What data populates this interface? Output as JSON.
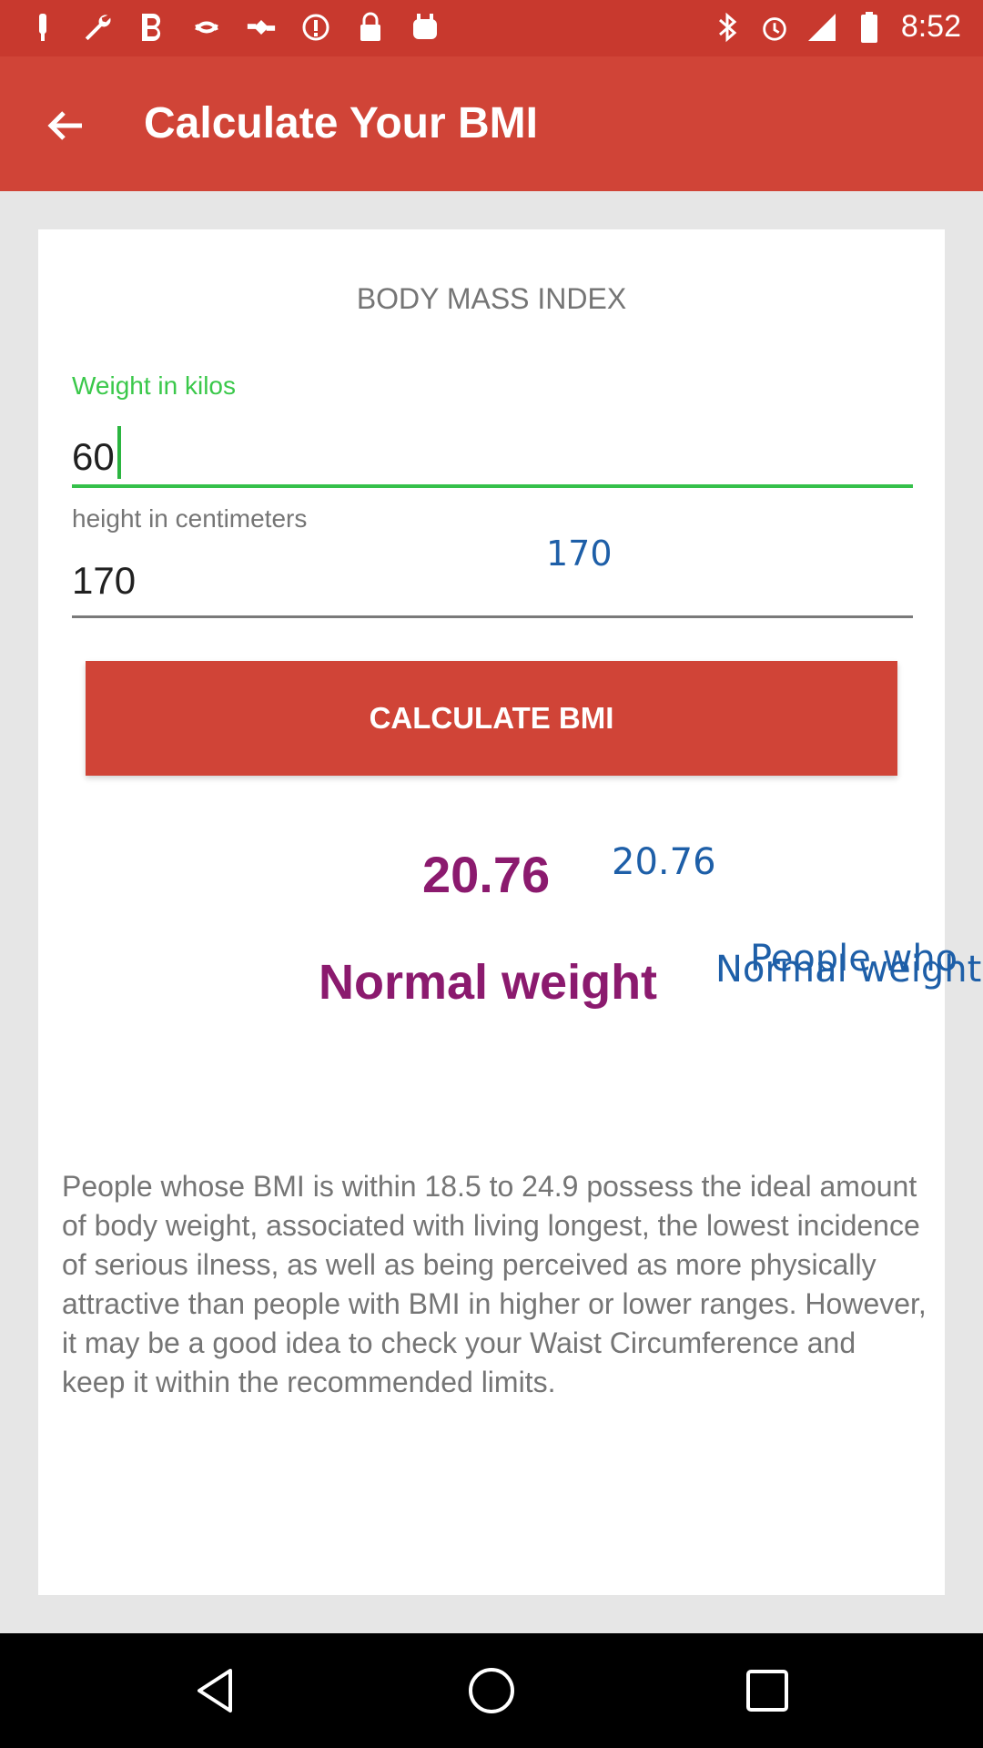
{
  "status_bar": {
    "time": "8:52",
    "icons_left": [
      "notification-icon",
      "wrench-icon",
      "b-icon",
      "sync-icon",
      "satellite-icon",
      "info-icon",
      "lock-icon",
      "android-icon"
    ],
    "icons_right": [
      "bluetooth-icon",
      "alarm-icon",
      "signal-icon",
      "battery-icon"
    ]
  },
  "app_bar": {
    "title": "Calculate Your BMI",
    "back_icon": "arrow-back-icon"
  },
  "form": {
    "heading": "BODY MASS INDEX",
    "weight_label": "Weight in kilos",
    "weight_value": "60",
    "height_label": "height in centimeters",
    "height_value": "170",
    "height_echo": "170",
    "button_label": "CALCULATE BMI"
  },
  "result": {
    "bmi": "20.76",
    "bmi_echo": "20.76",
    "category": "Normal weight",
    "category_echo": "Normal weight",
    "description": "People whose BMI is within 18.5 to 24.9 possess the ideal amount of body weight, associated with living longest, the lowest incidence of serious ilness, as well as being perceived as more physically attractive than people with BMI in higher or lower ranges. However, it may be a good idea to check your Waist Circumference and keep it within the recommended limits.",
    "description_echo": "People who"
  },
  "colors": {
    "primary": "#d04437",
    "status": "#c8392e",
    "accent_green": "#3ac84a",
    "result": "#8b1a6e",
    "debug_blue": "#1e5fa8"
  },
  "nav_bar": {
    "buttons": [
      "back-triangle-icon",
      "home-circle-icon",
      "recents-square-icon"
    ]
  }
}
